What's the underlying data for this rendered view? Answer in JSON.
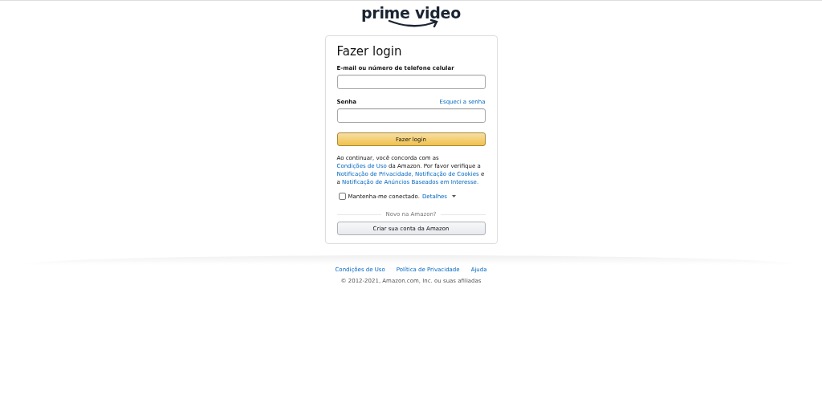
{
  "logo": {
    "text": "prime video"
  },
  "card": {
    "title": "Fazer login",
    "email": {
      "label": "E-mail ou número de telefone celular"
    },
    "password": {
      "label": "Senha",
      "forgot_link": "Esqueci a senha"
    },
    "submit": "Fazer login",
    "legal": [
      {
        "text": "Ao continuar, você concorda com as ",
        "link": false
      },
      {
        "text": "Condições de Uso",
        "link": true
      },
      {
        "text": " da Amazon. Por favor verifique a ",
        "link": false
      },
      {
        "text": "Notificação de Privacidade, ",
        "link": true
      },
      {
        "text": "Notificação de Cookies",
        "link": true
      },
      {
        "text": " e a ",
        "link": false
      },
      {
        "text": "Notificação de Anúncios Baseados em Interesse.",
        "link": true
      }
    ],
    "remember": {
      "label": "Mantenha-me conectado.",
      "checked": false,
      "details": "Detalhes"
    },
    "divider": "Novo na Amazon?",
    "create": "Criar sua conta da Amazon"
  },
  "footer": {
    "links": [
      "Condições de Uso",
      "Política de Privacidade",
      "Ajuda"
    ],
    "copyright": "© 2012-2021, Amazon.com, Inc. ou suas afiliadas"
  }
}
